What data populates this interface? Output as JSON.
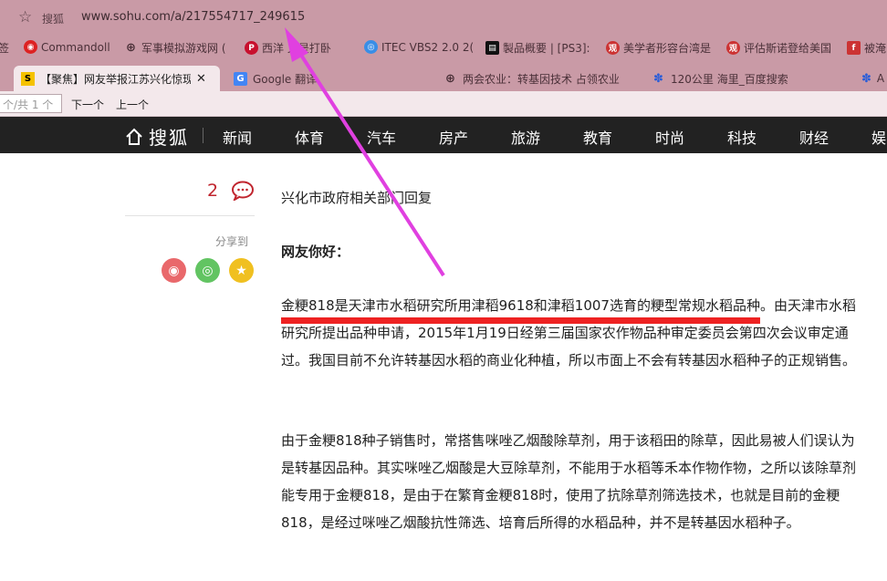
{
  "address_bar": {
    "site_label": "搜狐",
    "url": "www.sohu.com/a/217554717_249615"
  },
  "bookmarks": [
    {
      "label": "签",
      "icon": "bookmark-icon"
    },
    {
      "label": "Commandoll",
      "icon": "weibo-icon"
    },
    {
      "label": "军事模拟游戏网 (",
      "icon": "globe-icon"
    },
    {
      "label": "西洋    又是打卧",
      "icon": "pinterest-icon"
    },
    {
      "label": "ITEC VBS2 2.0 2(",
      "icon": "itec-icon"
    },
    {
      "label": "製品概要 | [PS3]:",
      "icon": "sega-icon"
    },
    {
      "label": "美学者形容台湾是",
      "icon": "news-icon"
    },
    {
      "label": "评估斯诺登给美国",
      "icon": "news-icon"
    },
    {
      "label": "被淹",
      "icon": "news-icon"
    }
  ],
  "tabs": [
    {
      "label": "【聚焦】网友举报江苏兴化惊现",
      "active": true
    },
    {
      "label": "Google 翻译",
      "active": false
    },
    {
      "label": "两会农业：转基因技术 占领农业",
      "active": false
    },
    {
      "label": "120公里 海里_百度搜索",
      "active": false
    },
    {
      "label": "A",
      "active": false
    }
  ],
  "findbar": {
    "placeholder": "个/共 1 个",
    "next": "下一个",
    "prev": "上一个"
  },
  "nav": {
    "logo": "搜狐",
    "items": [
      "新闻",
      "体育",
      "汽车",
      "房产",
      "旅游",
      "教育",
      "时尚",
      "科技",
      "财经",
      "娱"
    ]
  },
  "side": {
    "comment_count": "2",
    "share_label": "分享到"
  },
  "article": {
    "p1": "兴化市政府相关部门回复",
    "p2": "网友你好：",
    "p3_highlight": "金粳818是天津市水稻研究所用津稻9618和津稻1007选育的粳型常规水稻品种",
    "p3_rest": "。由天津市水稻研究所提出品种申请，2015年1月19日经第三届国家农作物品种审定委员会第四次会议审定通过。我国目前不允许转基因水稻的商业化种植，所以市面上不会有转基因水稻种子的正规销售。",
    "p4": "由于金粳818种子销售时，常搭售咪唑乙烟酸除草剂，用于该稻田的除草，因此易被人们误认为是转基因品种。其实咪唑乙烟酸是大豆除草剂，不能用于水稻等禾本作物作物，之所以该除草剂能专用于金粳818，是由于在繁育金粳818时，使用了抗除草剂筛选技术，也就是目前的金粳818，是经过咪唑乙烟酸抗性筛选、培育后所得的水稻品种，并不是转基因水稻种子。"
  },
  "colors": {
    "browser_chrome": "#c99aa6",
    "nav_bg": "#222222",
    "annotation": "#e040e0",
    "highlight": "#ee2222"
  }
}
